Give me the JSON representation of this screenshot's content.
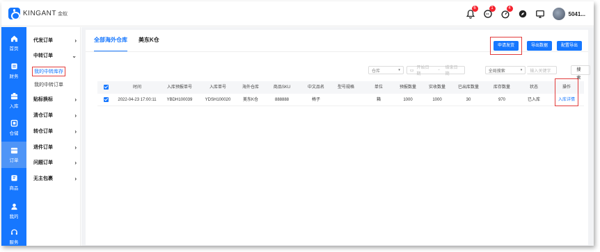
{
  "brand": {
    "name": "KINGANT",
    "sub": "金蚁"
  },
  "header": {
    "icons": [
      {
        "icon": "bell-icon",
        "badge": "6"
      },
      {
        "icon": "message-icon",
        "badge": "1"
      },
      {
        "icon": "task-icon",
        "badge": "4"
      },
      {
        "icon": "compass-icon",
        "badge": ""
      },
      {
        "icon": "monitor-icon",
        "badge": ""
      }
    ],
    "username": "5041..."
  },
  "leftnav": [
    {
      "label": "首页",
      "icon": "home-icon"
    },
    {
      "label": "财务",
      "icon": "finance-icon"
    },
    {
      "label": "入库",
      "icon": "inbound-icon"
    },
    {
      "label": "仓储",
      "icon": "warehouse-icon"
    },
    {
      "label": "订单",
      "icon": "order-icon",
      "active": true
    },
    {
      "label": "商品",
      "icon": "product-icon"
    },
    {
      "label": "我的",
      "icon": "user-icon"
    },
    {
      "label": "服务",
      "icon": "headset-icon"
    }
  ],
  "submenu": {
    "g1": "代发订单",
    "g2": "中转订单",
    "s1": "我的中转库存",
    "s2": "我的中转订单",
    "g3": "贴标换标",
    "g4": "清仓订单",
    "g5": "转仓订单",
    "g6": "退件订单",
    "g7": "问题订单",
    "g8": "无主包裹"
  },
  "tabs": [
    "全部海外仓库",
    "美东K仓"
  ],
  "buttons": {
    "apply": "申请发货",
    "export": "导出数据",
    "config": "配置导出"
  },
  "filters": {
    "warehouse_placeholder": "仓库",
    "start_date": "开始日期",
    "end_date": "结束日期",
    "search_scope": "全局搜索",
    "keyword_placeholder": "输入关键字",
    "search_button": "搜索"
  },
  "table": {
    "columns": [
      "时间",
      "入库预报单号",
      "入库单号",
      "海外仓库",
      "商品SKU",
      "中文品名",
      "型号规格",
      "单位",
      "预报数量",
      "实收数量",
      "已出库数量",
      "库存数量",
      "状态",
      "操作"
    ],
    "rows": [
      [
        "2022-04-23 17:00:11",
        "YBDH100039",
        "YDSH100020",
        "美东K仓",
        "888888",
        "椅子",
        "",
        "箱",
        "1000",
        "1000",
        "30",
        "970",
        "已入库",
        "入库详情"
      ]
    ]
  },
  "colors": {
    "primary": "#1677ff",
    "highlight": "#e23b3b",
    "badge": "#f5222d"
  }
}
